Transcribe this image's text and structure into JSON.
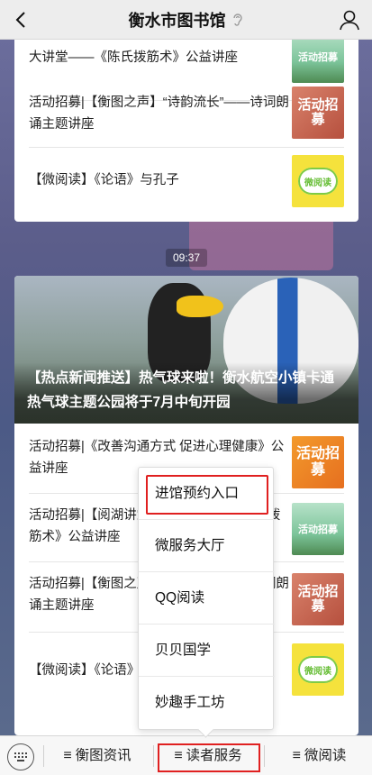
{
  "header": {
    "title": "衡水市图书馆"
  },
  "card_top": {
    "items": [
      {
        "text": "大讲堂——《陈氏拨筋术》公益讲座",
        "thumb": "活动招募"
      },
      {
        "text": "活动招募|【衡图之声】“诗韵流长”——诗词朗诵主题讲座",
        "thumb": "活动招募"
      },
      {
        "text": "【微阅读】《论语》与孔子",
        "thumb": "微阅读"
      }
    ]
  },
  "timestamp": "09:37",
  "card_main": {
    "headline": "【热点新闻推送】热气球来啦！衡水航空小镇卡通热气球主题公园将于7月中旬开园",
    "items": [
      {
        "text": "活动招募|《改善沟通方式 促进心理健康》公益讲座",
        "thumb": "活动招募"
      },
      {
        "text": "活动招募|【阅湖讲堂】大讲堂——《陈氏拨筋术》公益讲座",
        "thumb": "活动招募"
      },
      {
        "text": "活动招募|【衡图之声】“诗韵流长”——诗词朗诵主题讲座",
        "thumb": "活动招募"
      },
      {
        "text": "【微阅读】《论语》与孔子",
        "thumb": "微阅读"
      }
    ]
  },
  "popup_menu": {
    "items": [
      "进馆预约入口",
      "微服务大厅",
      "QQ阅读",
      "贝贝国学",
      "妙趣手工坊"
    ]
  },
  "bottom_menu": {
    "tabs": [
      "衡图资讯",
      "读者服务",
      "微阅读"
    ]
  },
  "colors": {
    "highlight": "#e02020",
    "topbar": "#ededed"
  }
}
